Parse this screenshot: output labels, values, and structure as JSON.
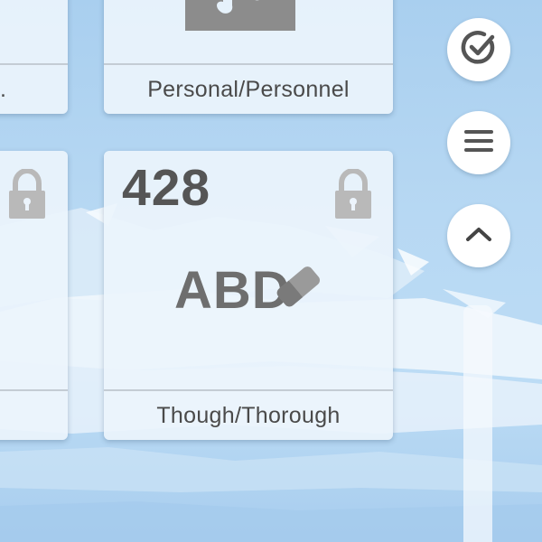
{
  "cards": {
    "top_left": {
      "label": "."
    },
    "top_center": {
      "label": "Personal/Personnel"
    },
    "mid_center": {
      "number": "428",
      "label": "Though/Thorough",
      "icon_text": "ABD"
    }
  },
  "icons": {
    "check": "check-circle-icon",
    "menu": "hamburger-menu-icon",
    "scroll_up": "chevron-up-icon",
    "lock": "lock-icon",
    "puzzle": "puzzle-icon",
    "eraser": "eraser-icon"
  },
  "colors": {
    "card_bg": "#ecf4fc",
    "text": "#4a4a4a",
    "number": "#555555",
    "icon_gray": "#b9b9b9",
    "puzzle_gray": "#8c8c8c",
    "button_icon": "#555555"
  }
}
